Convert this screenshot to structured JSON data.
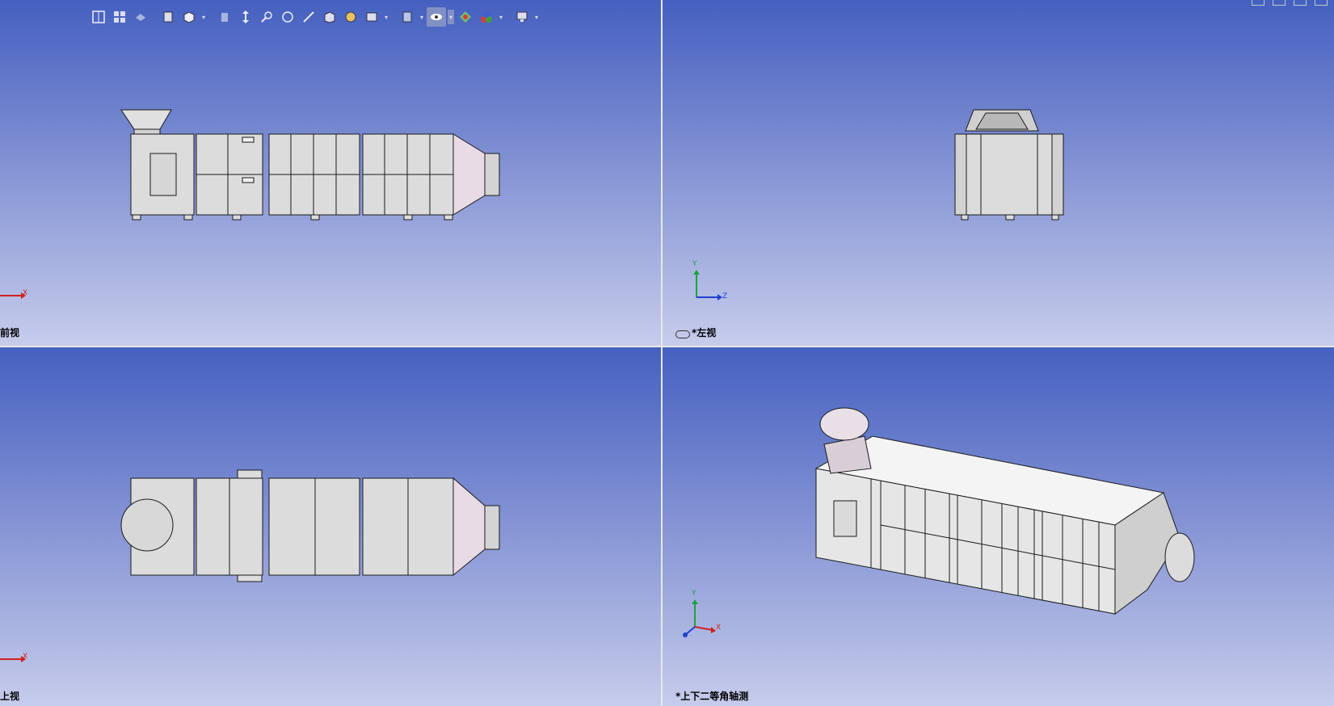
{
  "viewports": {
    "front": {
      "label": "前视"
    },
    "left": {
      "label": "*左视"
    },
    "top": {
      "label": "上视"
    },
    "iso": {
      "label": "*上下二等角轴测"
    }
  },
  "axes": {
    "x": "X",
    "y": "Y",
    "z": "Z"
  },
  "toolbar": {
    "icons": [
      "zoom-to-fit-icon",
      "zoom-area-icon",
      "previous-view-icon",
      "section-view-icon",
      "dynamic-annotation-icon",
      "view-orientation-icon",
      "display-style-icon",
      "hide-show-items-icon",
      "edit-appearance-icon",
      "apply-scene-icon",
      "view-settings-icon"
    ]
  },
  "colors": {
    "viewport_top": "#4560c0",
    "viewport_bottom": "#c6cceb",
    "model_fill": "#dcdcdc",
    "model_edge": "#1a1a1a",
    "axis_x": "#d02020",
    "axis_y": "#20a040",
    "axis_z": "#2040d0"
  }
}
